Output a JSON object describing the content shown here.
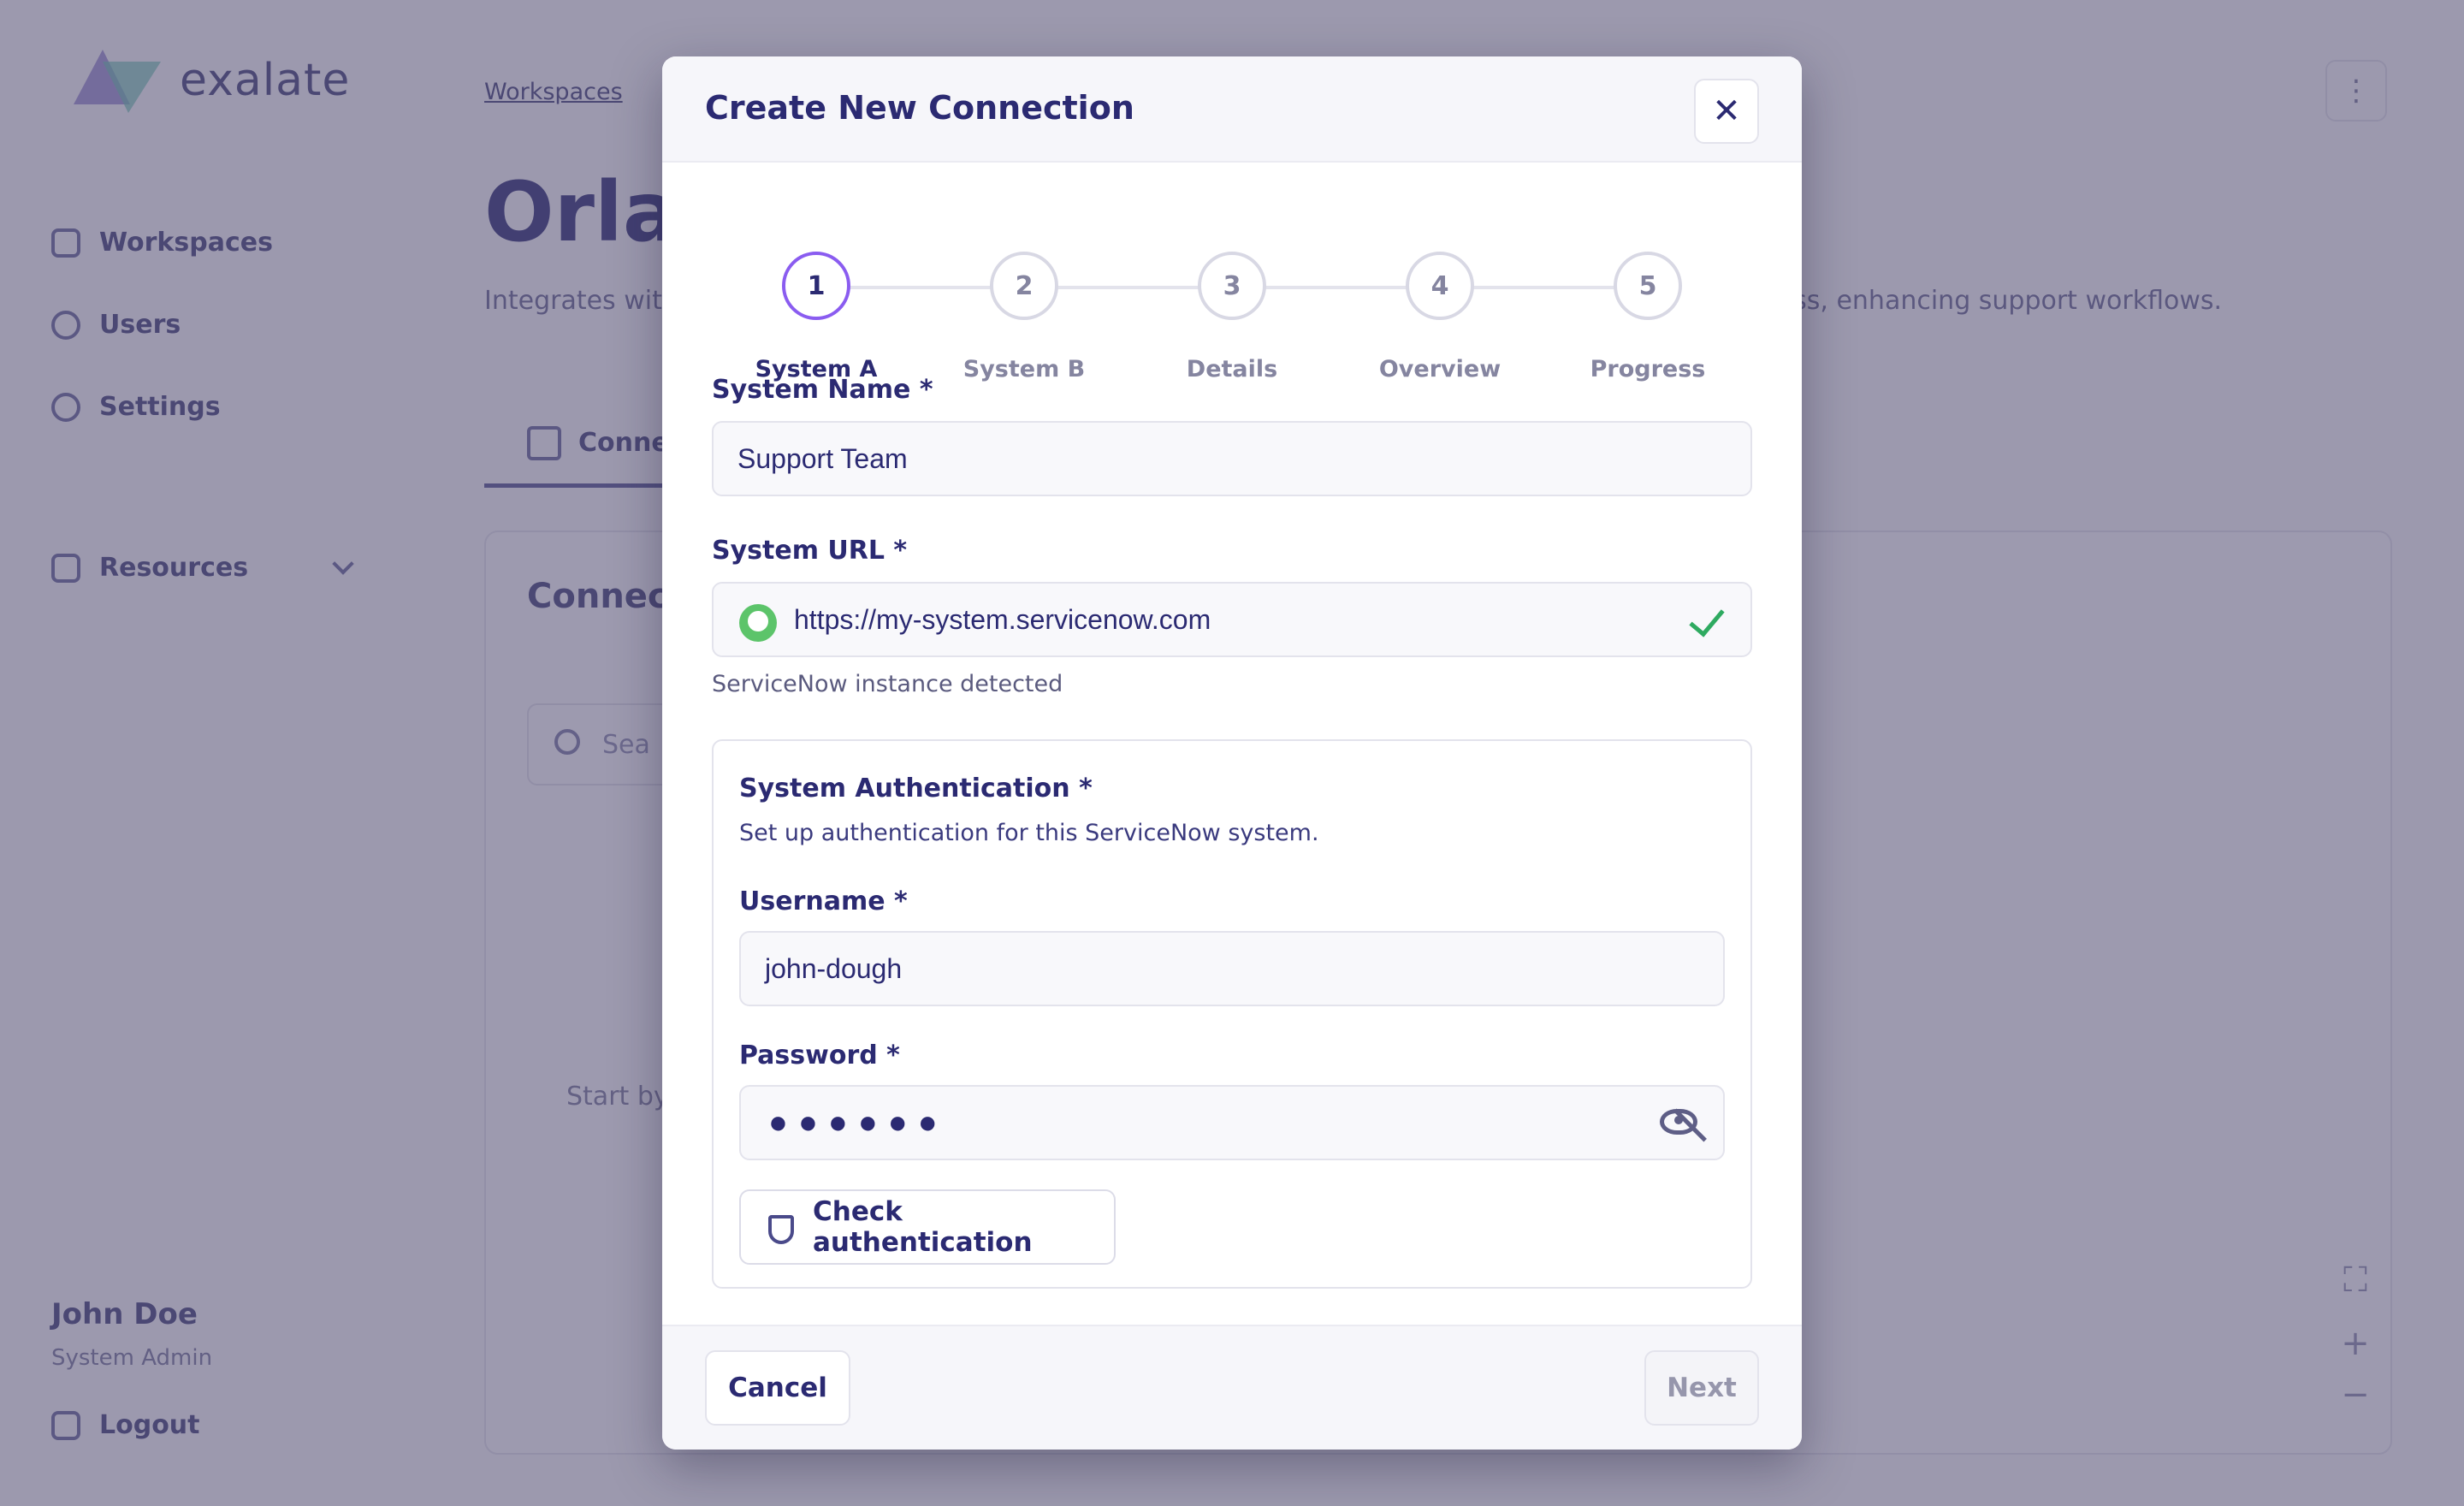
{
  "app": {
    "logo_text": "exalate",
    "nav": [
      {
        "label": "Workspaces",
        "icon": "workspaces-icon"
      },
      {
        "label": "Users",
        "icon": "user-icon"
      },
      {
        "label": "Settings",
        "icon": "gear-icon"
      },
      {
        "label": "Resources",
        "icon": "layers-icon"
      }
    ],
    "user": {
      "name": "John Doe",
      "role": "System Admin"
    },
    "logout_label": "Logout",
    "breadcrumb": "Workspaces",
    "page_title": "Orlan",
    "page_desc": "Integrates wit",
    "page_desc_end": "ress, enhancing support workflows.",
    "tab_label": "Conne",
    "card_title": "Connecti",
    "search_placeholder": "Sea",
    "empty_text": "Start by"
  },
  "modal": {
    "title": "Create New Connection",
    "steps": [
      {
        "number": "1",
        "label": "System A",
        "active": true
      },
      {
        "number": "2",
        "label": "System B",
        "active": false
      },
      {
        "number": "3",
        "label": "Details",
        "active": false
      },
      {
        "number": "4",
        "label": "Overview",
        "active": false
      },
      {
        "number": "5",
        "label": "Progress",
        "active": false
      }
    ],
    "system_name": {
      "label": "System Name *",
      "value": "Support Team"
    },
    "system_url": {
      "label": "System URL *",
      "value": "https://my-system.servicenow.com",
      "helper": "ServiceNow instance detected",
      "valid": true
    },
    "auth": {
      "title": "System Authentication *",
      "description": "Set up authentication for this ServiceNow system.",
      "username": {
        "label": "Username *",
        "value": "john-dough"
      },
      "password": {
        "label": "Password *",
        "masked_value": "●●●●●●"
      },
      "check_button": "Check authentication"
    },
    "cancel_label": "Cancel",
    "next_label": "Next"
  },
  "colors": {
    "primary_text": "#2b2a72",
    "active_step": "#8a5cf0",
    "success": "#2eaa60",
    "overlay": "#3a345c"
  }
}
